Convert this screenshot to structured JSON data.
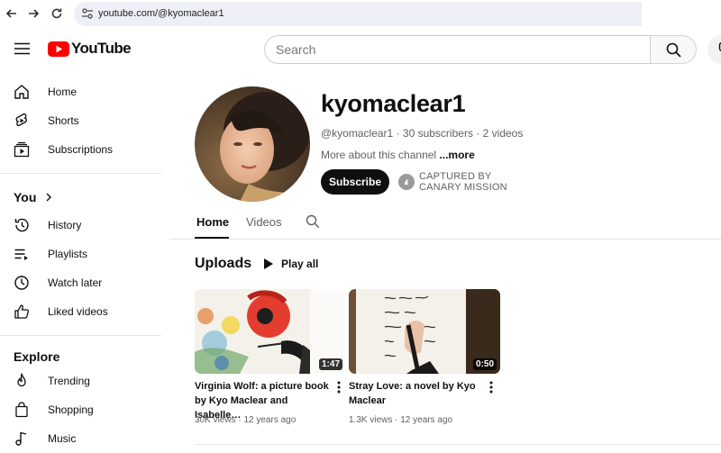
{
  "browser": {
    "url": "youtube.com/@kyomaclear1"
  },
  "header": {
    "logo_text": "YouTube",
    "search_placeholder": "Search"
  },
  "sidebar": {
    "main": [
      {
        "label": "Home",
        "icon": "home-icon"
      },
      {
        "label": "Shorts",
        "icon": "shorts-icon"
      },
      {
        "label": "Subscriptions",
        "icon": "subscriptions-icon"
      }
    ],
    "you_heading": "You",
    "you": [
      {
        "label": "History",
        "icon": "history-icon"
      },
      {
        "label": "Playlists",
        "icon": "playlists-icon"
      },
      {
        "label": "Watch later",
        "icon": "watch-later-icon"
      },
      {
        "label": "Liked videos",
        "icon": "liked-videos-icon"
      }
    ],
    "explore_heading": "Explore",
    "explore": [
      {
        "label": "Trending",
        "icon": "trending-icon"
      },
      {
        "label": "Shopping",
        "icon": "shopping-icon"
      },
      {
        "label": "Music",
        "icon": "music-icon"
      }
    ]
  },
  "channel": {
    "name": "kyomaclear1",
    "handle": "@kyomaclear1",
    "subscribers": "30 subscribers",
    "videos": "2 videos",
    "more_prefix": "More about this channel ",
    "more_link": "...more",
    "subscribe_label": "Subscribe",
    "captured_line1": "CAPTURED BY",
    "captured_line2": "CANARY MISSION"
  },
  "tabs": {
    "home": "Home",
    "videos": "Videos"
  },
  "uploads": {
    "title": "Uploads",
    "play_all": "Play all",
    "videos": [
      {
        "title_line1": "Virginia Wolf: a picture book",
        "title_line2": "by Kyo Maclear and Isabelle…",
        "duration": "1:47",
        "views": "30K views",
        "age": "12 years ago"
      },
      {
        "title_line1": "Stray Love: a novel by Kyo",
        "title_line2": "Maclear",
        "duration": "0:50",
        "views": "1.3K views",
        "age": "12 years ago"
      }
    ]
  },
  "colors": {
    "brand_red": "#ff0000",
    "text": "#0f0f0f",
    "secondary": "#606060"
  }
}
